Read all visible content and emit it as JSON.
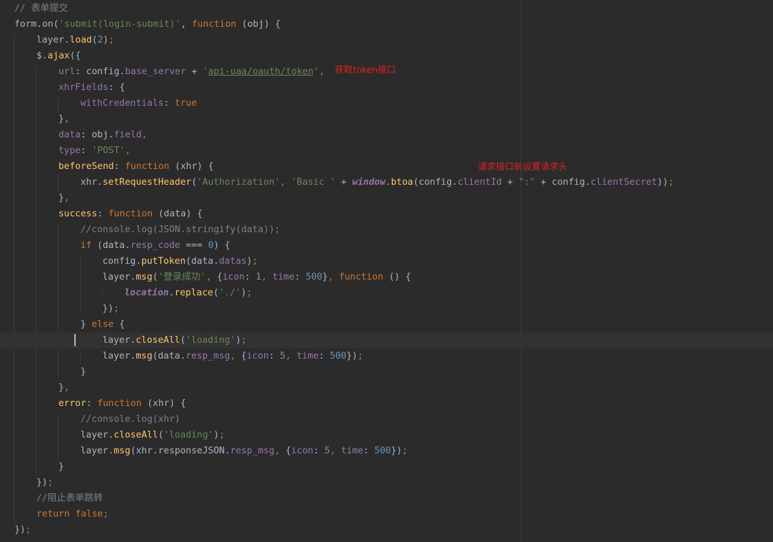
{
  "code": {
    "comment_submit": "// 表单提交",
    "lines": [
      "form.on('submit(login-submit)', function (obj) {",
      "layer.load(2);",
      "$.ajax({",
      "url: config.base_server + 'api-uaa/oauth/token',",
      "xhrFields: {",
      "withCredentials: true",
      "},",
      "data: obj.field,",
      "type: 'POST',",
      "beforeSend: function (xhr) {",
      "xhr.setRequestHeader('Authorization', 'Basic ' + window.btoa(config.clientId + \":\" + config.clientSecret));",
      "},",
      "success: function (data) {",
      "//console.log(JSON.stringify(data));",
      "if (data.resp_code === 0) {",
      "config.putToken(data.datas);",
      "layer.msg('登录成功', {icon: 1, time: 500}, function () {",
      "location.replace('./');",
      "});",
      "} else {",
      "layer.closeAll('loading');",
      "layer.msg(data.resp_msg, {icon: 5, time: 500});",
      "}",
      "},",
      "error: function (xhr) {",
      "//console.log(xhr)",
      "layer.closeAll('loading');",
      "layer.msg(xhr.responseJSON.resp_msg, {icon: 5, time: 500});",
      "}",
      "});",
      "//阻止表单跳转",
      "return false;",
      "});"
    ]
  },
  "annotations": {
    "token_note": "获取token接口",
    "header_note": "请求接口前设置请求头"
  },
  "colors": {
    "background": "#2b2b2b",
    "default_text": "#a9b7c6",
    "keyword": "#cc7832",
    "string": "#6a8759",
    "number": "#6897bb",
    "property": "#9876aa",
    "method": "#ffc66d",
    "comment": "#808080",
    "annotation": "#e02020"
  }
}
